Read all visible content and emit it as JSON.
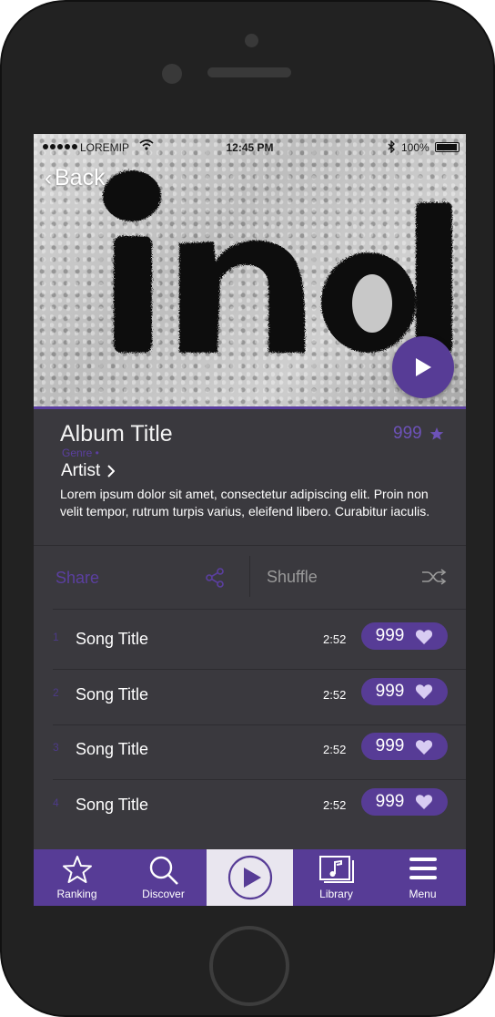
{
  "status_bar": {
    "carrier": "LOREMIP",
    "time": "12:45 PM",
    "battery": "100%"
  },
  "hero": {
    "back_label": "Back",
    "back_icon": "chevron-left-icon",
    "play_icon": "play-icon",
    "artwork_text": "ind"
  },
  "album": {
    "title": "Album Title",
    "rating": "999",
    "rating_icon": "star-icon",
    "genre": "Genre •",
    "artist": "Artist",
    "artist_icon": "chevron-right-icon",
    "description": "Lorem ipsum dolor sit amet, consectetur adipiscing elit. Proin non velit tempor, rutrum turpis varius, eleifend libero. Curabitur iaculis."
  },
  "actions": {
    "share_label": "Share",
    "share_icon": "share-icon",
    "shuffle_label": "Shuffle",
    "shuffle_icon": "shuffle-icon"
  },
  "songs": [
    {
      "number": "1",
      "title": "Song Title",
      "duration": "2:52",
      "likes": "999"
    },
    {
      "number": "2",
      "title": "Song Title",
      "duration": "2:52",
      "likes": "999"
    },
    {
      "number": "3",
      "title": "Song Title",
      "duration": "2:52",
      "likes": "999"
    },
    {
      "number": "4",
      "title": "Song Title",
      "duration": "2:52",
      "likes": "999"
    }
  ],
  "tabbar": {
    "ranking": "Ranking",
    "discover": "Discover",
    "library": "Library",
    "menu": "Menu"
  },
  "colors": {
    "accent": "#573c96",
    "background": "#3a393e",
    "frame": "#222222"
  }
}
